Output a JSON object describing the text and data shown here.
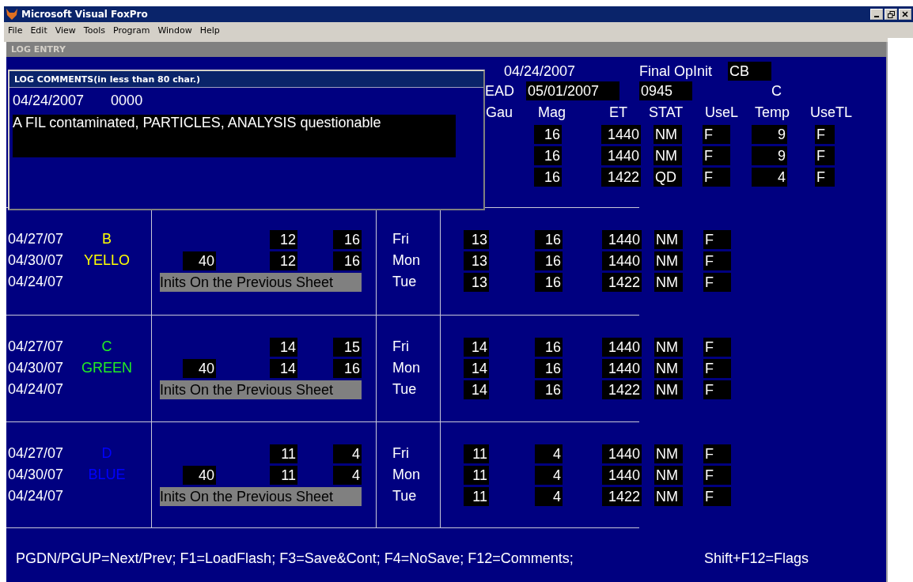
{
  "window": {
    "title": "Microsoft Visual FoxPro"
  },
  "menu": [
    "File",
    "Edit",
    "View",
    "Tools",
    "Program",
    "Window",
    "Help"
  ],
  "form_title": "LOG ENTRY",
  "header": {
    "date": "04/24/2007",
    "final_label": "Final OpInit",
    "final_value": "CB",
    "read_label": "EAD",
    "read_date": "05/01/2007",
    "read_time": "0945",
    "c_label": "C"
  },
  "columns": [
    "Gau",
    "Mag",
    "ET",
    "STAT",
    "UseL",
    "Temp",
    "UseTL"
  ],
  "groups": [
    {
      "rows": [
        {
          "mag": "16",
          "et": "1440",
          "stat": "NM",
          "usel": "F",
          "temp": "9",
          "usetl": "F"
        },
        {
          "mag": "16",
          "et": "1440",
          "stat": "NM",
          "usel": "F",
          "temp": "9",
          "usetl": "F"
        },
        {
          "mag": "16",
          "et": "1422",
          "stat": "QD",
          "usel": "F",
          "temp": "4",
          "usetl": "F"
        }
      ]
    },
    {
      "color": "#ffff00",
      "rows": [
        {
          "date": "04/27/07",
          "code": "B",
          "n2": "12",
          "n3": "16",
          "day": "Fri",
          "gau": "13",
          "mag": "16",
          "et": "1440",
          "stat": "NM",
          "usel": "F"
        },
        {
          "date": "04/30/07",
          "code": "YELLO",
          "n1": "40",
          "n2": "12",
          "n3": "16",
          "day": "Mon",
          "gau": "13",
          "mag": "16",
          "et": "1440",
          "stat": "NM",
          "usel": "F"
        },
        {
          "date": "04/24/07",
          "note": "Inits On the Previous Sheet",
          "day": "Tue",
          "gau": "13",
          "mag": "16",
          "et": "1422",
          "stat": "NM",
          "usel": "F"
        }
      ]
    },
    {
      "color": "#22ee22",
      "rows": [
        {
          "date": "04/27/07",
          "code": "C",
          "n2": "14",
          "n3": "15",
          "day": "Fri",
          "gau": "14",
          "mag": "16",
          "et": "1440",
          "stat": "NM",
          "usel": "F"
        },
        {
          "date": "04/30/07",
          "code": "GREEN",
          "n1": "40",
          "n2": "14",
          "n3": "16",
          "day": "Mon",
          "gau": "14",
          "mag": "16",
          "et": "1440",
          "stat": "NM",
          "usel": "F"
        },
        {
          "date": "04/24/07",
          "note": "Inits On the Previous Sheet",
          "day": "Tue",
          "gau": "14",
          "mag": "16",
          "et": "1422",
          "stat": "NM",
          "usel": "F"
        }
      ]
    },
    {
      "color": "#0000ff",
      "rows": [
        {
          "date": "04/27/07",
          "code": "D",
          "n2": "11",
          "n3": "4",
          "day": "Fri",
          "gau": "11",
          "mag": "4",
          "et": "1440",
          "stat": "NM",
          "usel": "F"
        },
        {
          "date": "04/30/07",
          "code": "BLUE",
          "n1": "40",
          "n2": "11",
          "n3": "4",
          "day": "Mon",
          "gau": "11",
          "mag": "4",
          "et": "1440",
          "stat": "NM",
          "usel": "F"
        },
        {
          "date": "04/24/07",
          "note": "Inits On the Previous Sheet",
          "day": "Tue",
          "gau": "11",
          "mag": "4",
          "et": "1422",
          "stat": "NM",
          "usel": "F"
        }
      ]
    }
  ],
  "comments_dialog": {
    "title": "LOG COMMENTS(in less than 80 char.)",
    "date": "04/24/2007",
    "time": "0000",
    "text": "A FIL contaminated, PARTICLES, ANALYSIS questionable"
  },
  "footer": {
    "keys": "PGDN/PGUP=Next/Prev; F1=LoadFlash; F3=Save&Cont; F4=NoSave; F12=Comments;",
    "flags": "Shift+F12=Flags"
  }
}
